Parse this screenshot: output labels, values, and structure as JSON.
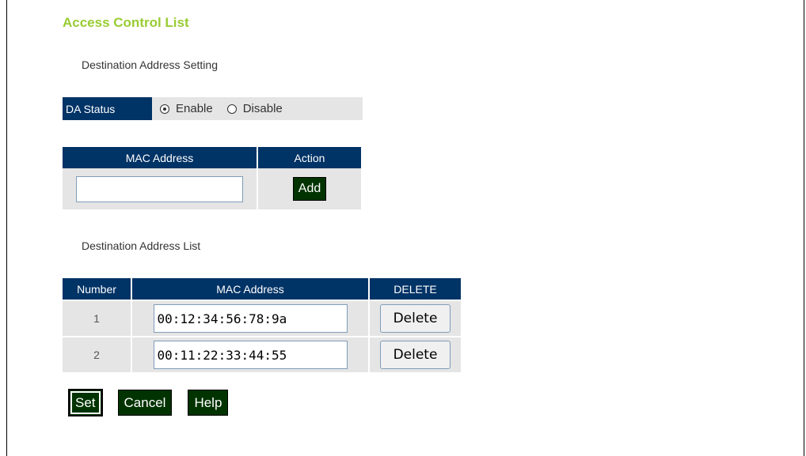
{
  "page": {
    "title": "Access Control List"
  },
  "setting_section": {
    "heading": "Destination Address Setting",
    "status_label": "DA Status",
    "options": [
      {
        "label": "Enable",
        "checked": true
      },
      {
        "label": "Disable",
        "checked": false
      }
    ]
  },
  "add_table": {
    "headers": [
      "MAC Address",
      "Action"
    ],
    "input_value": "",
    "add_label": "Add"
  },
  "list_section": {
    "heading": "Destination Address List",
    "headers": [
      "Number",
      "MAC Address",
      "DELETE"
    ],
    "rows": [
      {
        "number": "1",
        "mac": "00:12:34:56:78:9a",
        "delete_label": "Delete"
      },
      {
        "number": "2",
        "mac": "00:11:22:33:44:55",
        "delete_label": "Delete"
      }
    ]
  },
  "buttons": {
    "set": "Set",
    "cancel": "Cancel",
    "help": "Help"
  },
  "colors": {
    "title": "#99cc33",
    "header_bg": "#003366",
    "button_bg": "#003300",
    "cell_bg": "#e5e5e5"
  }
}
